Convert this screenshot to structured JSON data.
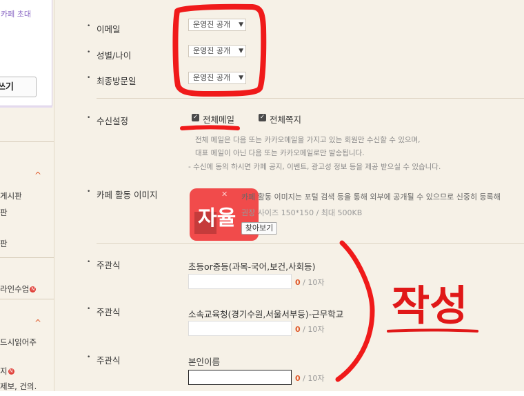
{
  "sidebar": {
    "invite_text": "카페 초대",
    "write_button": "쓰기",
    "items": [
      "게시판",
      "판",
      "판",
      "라인수업",
      "드시읽어주",
      "지",
      "제보, 건의."
    ]
  },
  "form": {
    "email": {
      "label": "이메일",
      "value": "운영진 공개"
    },
    "gender_age": {
      "label": "성별/나이",
      "value": "운영진 공개"
    },
    "last_visit": {
      "label": "최종방문일",
      "value": "운영진 공개"
    },
    "receive": {
      "label": "수신설정",
      "option_mail": "전체메일",
      "option_note": "전체쪽지",
      "note1": "전체 메일은 다음 또는 카카오메일을 가지고 있는 회원만 수신할 수 있으며,",
      "note2": "대표 메일이 아닌 다음 또는 카카오메일로만 발송됩니다.",
      "note3": "- 수신에 동의 하시면 카페 공지, 이벤트, 광고성 정보 등을 제공 받으실 수 있습니다."
    },
    "activity_image": {
      "label": "카페 활동 이미지",
      "desc1": "카페 활동 이미지는 포털 검색 등을 통해 외부에 공개될 수 있으므로 신중히 등록해",
      "desc2": "권장 사이즈 150*150 / 최대 500KB",
      "find_button": "찾아보기"
    },
    "questions": [
      {
        "label": "주관식",
        "title": "초등or중등(과목-국어,보건,사회등)",
        "count": "0",
        "max": "/ 10자"
      },
      {
        "label": "주관식",
        "title": "소속교육청(경기수원,서울서부등)-근무학교",
        "count": "0",
        "max": "/ 10자"
      },
      {
        "label": "주관식",
        "title": "본인이름",
        "count": "0",
        "max": "/ 10자"
      }
    ]
  },
  "annotations": {
    "free_text": "자율",
    "write_text": "작성"
  },
  "colors": {
    "background": "#f6f1e7",
    "accent": "#e05a2b",
    "annotation": "#f01a1a"
  }
}
